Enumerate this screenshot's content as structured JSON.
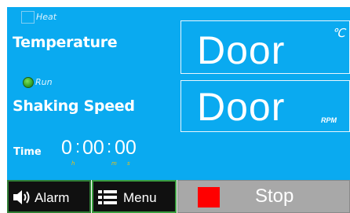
{
  "indicators": {
    "heat_label": "Heat",
    "run_label": "Run"
  },
  "temperature": {
    "label": "Temperature",
    "value": "Door",
    "unit": "℃"
  },
  "shaking_speed": {
    "label": "Shaking Speed",
    "value": "Door",
    "unit": "RPM"
  },
  "timer": {
    "label": "Time",
    "hours": "0",
    "minutes": "00",
    "seconds": "00",
    "separator": ":",
    "hours_unit": "h",
    "minutes_unit": "m",
    "seconds_unit": "s"
  },
  "buttons": {
    "alarm_label": "Alarm",
    "menu_label": "Menu",
    "stop_label": "Stop"
  },
  "colors": {
    "panel": "#0aaaf0",
    "stop_indicator": "#ff0000",
    "run_led": "#3aa82a",
    "time_unit": "#f2c10f"
  }
}
